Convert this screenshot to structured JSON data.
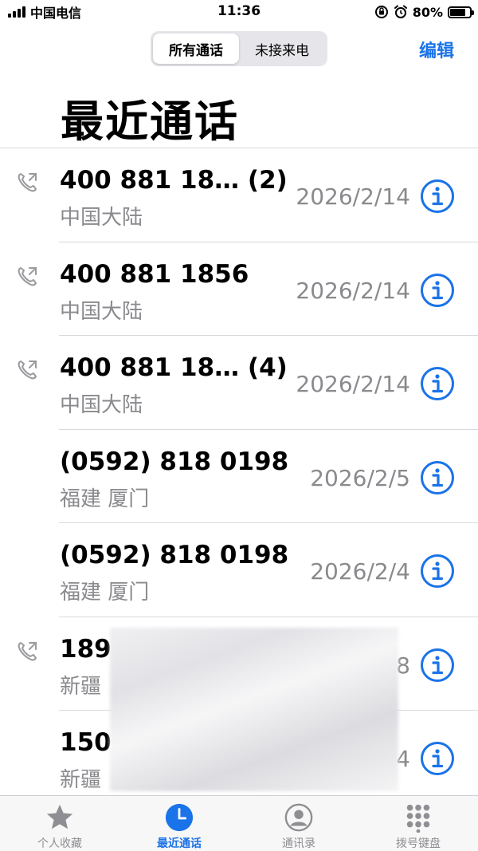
{
  "status_bar": {
    "carrier": "中国电信",
    "time": "11:36",
    "battery_percent": "80%",
    "battery_level": 0.8
  },
  "header": {
    "segments": [
      {
        "label": "所有通话",
        "selected": true
      },
      {
        "label": "未接来电",
        "selected": false
      }
    ],
    "edit_label": "编辑",
    "title": "最近通话"
  },
  "colors": {
    "accent": "#1a73e8",
    "secondary_text": "#8a8a8e",
    "separator": "#d9d9dd"
  },
  "calls": [
    {
      "name": "400 881 18… (2)",
      "location": "中国大陆",
      "date": "2026/2/14",
      "outgoing": true
    },
    {
      "name": "400 881 1856",
      "location": "中国大陆",
      "date": "2026/2/14",
      "outgoing": true
    },
    {
      "name": "400 881 18… (4)",
      "location": "中国大陆",
      "date": "2026/2/14",
      "outgoing": true
    },
    {
      "name": "(0592) 818 0198",
      "location": "福建 厦门",
      "date": "2026/2/5",
      "outgoing": false
    },
    {
      "name": "(0592) 818 0198",
      "location": "福建 厦门",
      "date": "2026/2/4",
      "outgoing": false
    },
    {
      "name": "189",
      "location": "新疆",
      "date": "8",
      "outgoing": true
    },
    {
      "name": "150",
      "location": "新疆",
      "date": "4",
      "outgoing": false
    }
  ],
  "tab_bar": {
    "tabs": [
      {
        "label": "个人收藏",
        "icon": "star-icon",
        "active": false
      },
      {
        "label": "最近通话",
        "icon": "clock-icon",
        "active": true
      },
      {
        "label": "通讯录",
        "icon": "contacts-icon",
        "active": false
      },
      {
        "label": "拨号键盘",
        "icon": "keypad-icon",
        "active": false
      }
    ]
  }
}
